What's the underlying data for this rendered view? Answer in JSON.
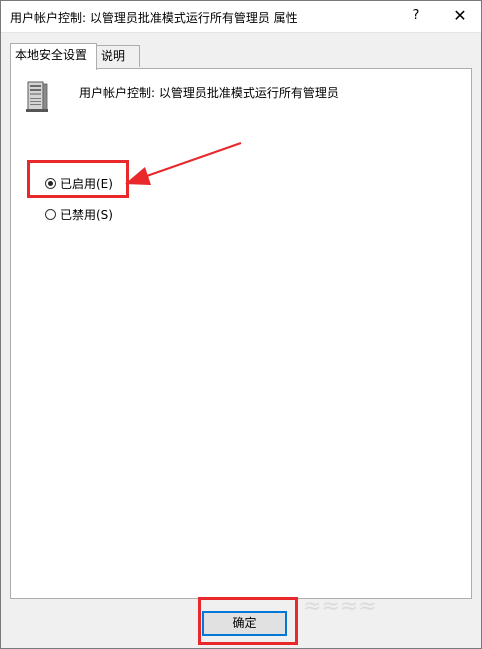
{
  "window": {
    "title": "用户帐户控制: 以管理员批准模式运行所有管理员 属性",
    "help_label": "?",
    "close_label": "✕"
  },
  "tabs": [
    {
      "label": "本地安全设置",
      "active": true
    },
    {
      "label": "说明",
      "active": false
    }
  ],
  "policy": {
    "icon": "server-policy-icon",
    "name": "用户帐户控制: 以管理员批准模式运行所有管理员"
  },
  "options": [
    {
      "label": "已启用(E)",
      "checked": true
    },
    {
      "label": "已禁用(S)",
      "checked": false
    }
  ],
  "buttons": {
    "ok_label": "确定"
  },
  "annotations": {
    "highlight_color": "#e8282b"
  },
  "watermark": {
    "text": "≈≈≈≈"
  }
}
